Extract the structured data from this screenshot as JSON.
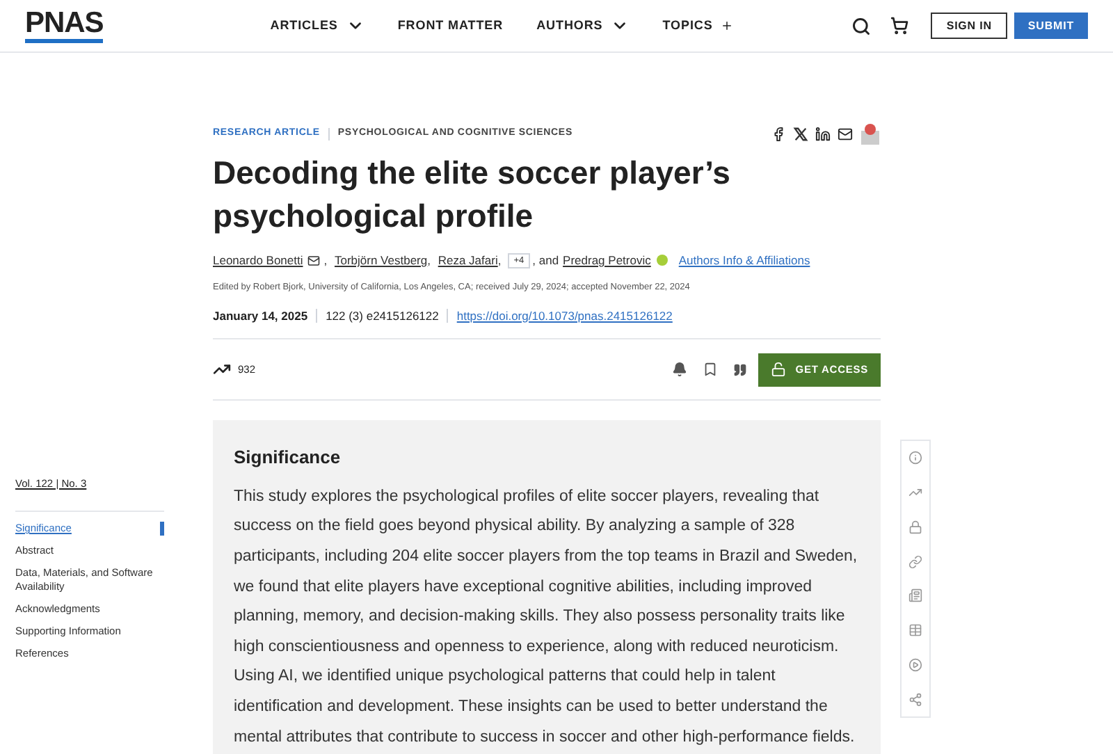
{
  "header": {
    "logo": "PNAS",
    "nav": [
      {
        "label": "ARTICLES",
        "kind": "dropdown"
      },
      {
        "label": "FRONT MATTER",
        "kind": "link"
      },
      {
        "label": "AUTHORS",
        "kind": "dropdown"
      },
      {
        "label": "TOPICS",
        "kind": "expand"
      }
    ],
    "sign_in": "SIGN IN",
    "submit": "SUBMIT"
  },
  "article": {
    "type": "RESEARCH ARTICLE",
    "section": "PSYCHOLOGICAL AND COGNITIVE SCIENCES",
    "title": "Decoding the elite soccer player’s psychological profile",
    "authors": [
      {
        "name": "Leonardo Bonetti",
        "kind": "email"
      },
      {
        "name": ", ",
        "kind": "sep"
      },
      {
        "name": "Torbjörn Vestberg",
        "kind": "plain"
      },
      {
        "name": ", ",
        "kind": "sep"
      },
      {
        "name": "Reza Jafari",
        "kind": "plain"
      },
      {
        "name": ",",
        "kind": "sep"
      },
      {
        "name": "+4",
        "kind": "more"
      },
      {
        "name": ", and",
        "kind": "sep"
      },
      {
        "name": "Predrag Petrovic",
        "kind": "orcid"
      }
    ],
    "affiliations_link": "Authors Info & Affiliations",
    "edited": "Edited by Robert Bjork, University of California, Los Angeles, CA; received July 29, 2024; accepted November 22, 2024",
    "date": "January 14, 2025",
    "citation": "122 (3) e2415126122",
    "doi": "https://doi.org/10.1073/pnas.2415126122",
    "metric": "932",
    "get_access": "GET ACCESS"
  },
  "sidebar": {
    "issue": "Vol. 122 | No. 3",
    "items": [
      {
        "label": "Significance",
        "selected": true
      },
      {
        "label": "Abstract",
        "selected": false
      },
      {
        "label": "Data, Materials, and Software Availability",
        "selected": false
      },
      {
        "label": "Acknowledgments",
        "selected": false
      },
      {
        "label": "Supporting Information",
        "selected": false
      },
      {
        "label": "References",
        "selected": false
      }
    ]
  },
  "significance": {
    "heading": "Significance",
    "body": "This study explores the psychological profiles of elite soccer players, revealing that success on the field goes beyond physical ability. By analyzing a sample of 328 participants, including 204 elite soccer players from the top teams in Brazil and Sweden, we found that elite players have exceptional cognitive abilities, including improved planning, memory, and decision-making skills. They also possess personality traits like high conscientiousness and openness to experience, along with reduced neuroticism. Using AI, we identified unique psychological patterns that could help in talent identification and development. These insights can be used to better understand the mental attributes that contribute to success in soccer and other high-performance fields."
  }
}
